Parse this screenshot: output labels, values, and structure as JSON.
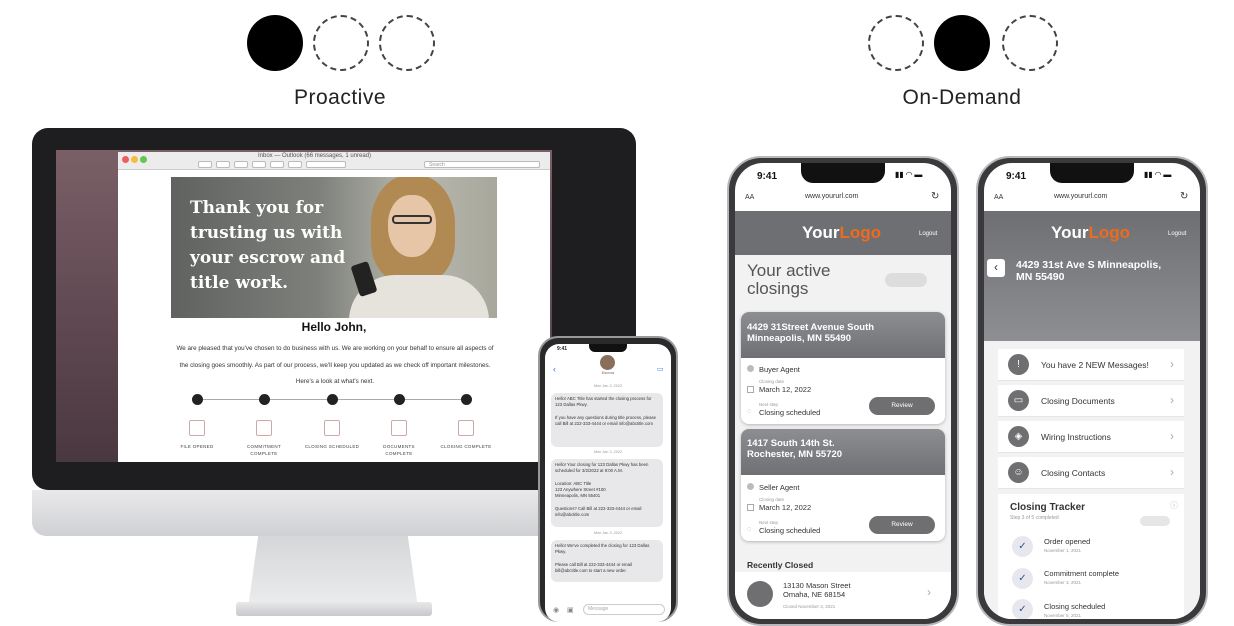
{
  "sections": {
    "proactive": {
      "label": "Proactive"
    },
    "on_demand": {
      "label": "On-Demand"
    }
  },
  "desktop_email": {
    "window_title": "Inbox — Outlook    (66 messages, 1 unread)",
    "search_placeholder": "Search",
    "hero_text": "Thank you for trusting us with your escrow and title work.",
    "greeting": "Hello John,",
    "body": "We are pleased that you've chosen to do business with us. We are working on your behalf to ensure all aspects of the closing goes smoothly. As part of our process, we'll keep you updated as we check off important milestones. Here's a look at what's next.",
    "milestones": [
      {
        "label": "FILE OPENED"
      },
      {
        "label": "COMMITMENT COMPLETE"
      },
      {
        "label": "CLOSING SCHEDULED"
      },
      {
        "label": "DOCUMENTS COMPLETE"
      },
      {
        "label": "CLOSING COMPLETE"
      }
    ]
  },
  "sms_phone": {
    "time": "9:41",
    "contact": "Escrow",
    "messages": [
      {
        "date": "Mon Jan 3, 2022",
        "text": "Hello! ABC Title has started the closing process for 123 Dallas Pkwy.\n\nIf you have any questions during title process, please call Bill at 222-333-4444 or email info@abctitle.com"
      },
      {
        "date": "Mon Jan 3, 2022",
        "text": "Hello! Your closing for 123 Dallas Pkwy has been scheduled for 3/2/2022 at 9:00 A.M.\n\nLocation: ABC Title\n123 Anywhere Street #100\nMinneapolis, MN 55401\n\nQuestions? Call Bill at 222-333-4444 or email info@abctitle.com"
      },
      {
        "date": "Mon Jan 3, 2022",
        "text": "Hello! We've completed the closing for 123 Dallas Pkwy.\n\nPlease call Bill at 222-333-4444 or email bill@abctitle.com to start a new order."
      }
    ],
    "input_placeholder": "Message"
  },
  "phone_a": {
    "time": "9:41",
    "aa": "AA",
    "url": "www.yoururl.com",
    "logo_main": "Your",
    "logo_accent": "Logo",
    "logout": "Logout",
    "page_title": "Your active closings",
    "closings": [
      {
        "address": "4429 31Street Avenue South Minneapolis, MN 55490",
        "role": "Buyer Agent",
        "date_caption": "Closing date",
        "date": "March 12, 2022",
        "status_caption": "Next step",
        "status": "Closing scheduled",
        "action": "Review"
      },
      {
        "address": "1417 South 14th St. Rochester, MN 55720",
        "role": "Seller Agent",
        "date_caption": "Closing date",
        "date": "March 12, 2022",
        "status_caption": "Next step",
        "status": "Closing scheduled",
        "action": "Review"
      }
    ],
    "recently_closed_title": "Recently Closed",
    "recently_closed": {
      "address": "13130 Mason Street Omaha, NE 68154",
      "caption": "Closed November 3, 2021"
    }
  },
  "phone_b": {
    "time": "9:41",
    "aa": "AA",
    "url": "www.yoururl.com",
    "logo_main": "Your",
    "logo_accent": "Logo",
    "logout": "Logout",
    "address": "4429 31st Ave S Minneapolis, MN 55490",
    "menu": [
      {
        "icon": "!",
        "label": "You have 2 NEW Messages!"
      },
      {
        "icon": "▭",
        "label": "Closing Documents"
      },
      {
        "icon": "◈",
        "label": "Wiring Instructions"
      },
      {
        "icon": "☺",
        "label": "Closing Contacts"
      }
    ],
    "tracker_title": "Closing Tracker",
    "tracker_subtitle": "Step 3 of 5 completed",
    "tracker": [
      {
        "label": "Order opened",
        "date": "November 1, 2021"
      },
      {
        "label": "Commitment complete",
        "date": "November 3, 2021"
      },
      {
        "label": "Closing scheduled",
        "date": "November 5, 2021"
      }
    ]
  },
  "colors": {
    "accent": "#f06a1d",
    "dark_gray": "#6f6f72",
    "check_blue": "#3b4a99"
  }
}
